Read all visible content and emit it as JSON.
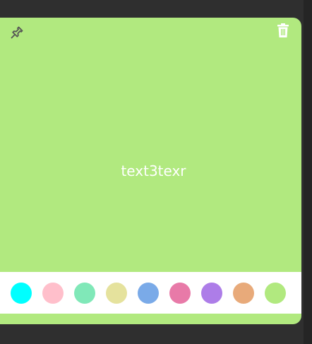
{
  "note": {
    "text": "text3texr",
    "background": "#b1e97f",
    "pin_icon": "pin-icon",
    "trash_icon": "trash-icon"
  },
  "palette": [
    {
      "name": "cyan",
      "color": "#00ffff"
    },
    {
      "name": "pink",
      "color": "#ffbfcb"
    },
    {
      "name": "mint",
      "color": "#80e8b8"
    },
    {
      "name": "khaki",
      "color": "#e5e29d"
    },
    {
      "name": "blue",
      "color": "#7aaae8"
    },
    {
      "name": "rose",
      "color": "#e87aa8"
    },
    {
      "name": "purple",
      "color": "#ad7de8"
    },
    {
      "name": "peach",
      "color": "#e8aa7a"
    },
    {
      "name": "green",
      "color": "#b1e97f"
    }
  ]
}
